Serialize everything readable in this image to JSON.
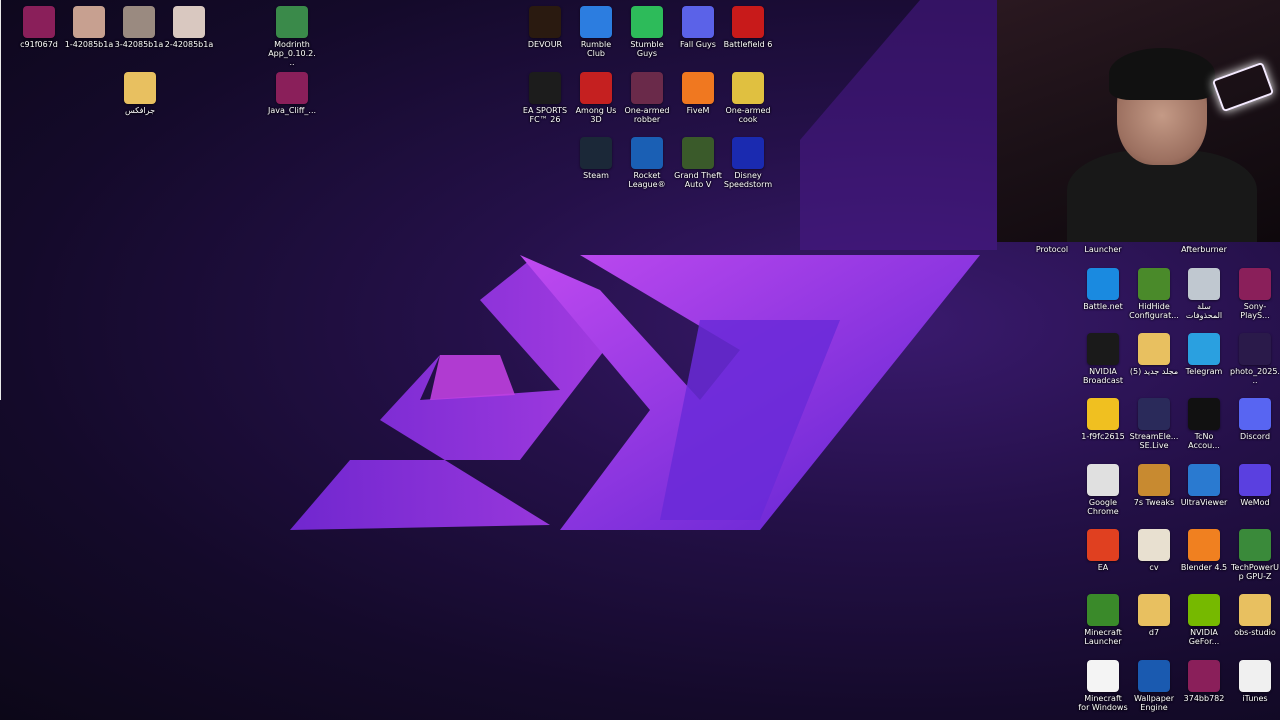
{
  "left_icons": [
    {
      "label": "c91f067d",
      "icon": "winrar-icon",
      "color": "#8a1f5a"
    },
    {
      "label": "1-42085b1a",
      "icon": "image-icon",
      "color": "#c7a090"
    },
    {
      "label": "3-42085b1a",
      "icon": "image-icon",
      "color": "#9a8a80"
    },
    {
      "label": "2-42085b1a",
      "icon": "image-icon",
      "color": "#d9c8c0"
    },
    {
      "label": "Modrinth App_0.10.2...",
      "icon": "modrinth-icon",
      "color": "#3a8a4a"
    },
    {
      "label": "جرافكس",
      "icon": "folder-icon",
      "color": "#e8c060"
    },
    {
      "label": "Java_Cliff_...",
      "icon": "winrar-icon",
      "color": "#8a1f5a"
    }
  ],
  "top_icons": [
    {
      "label": "DEVOUR",
      "icon": "devour-icon",
      "color": "#2a1a10"
    },
    {
      "label": "Rumble Club",
      "icon": "rumble-club-icon",
      "color": "#2c7de0"
    },
    {
      "label": "Stumble Guys",
      "icon": "stumble-guys-icon",
      "color": "#2dbb5a"
    },
    {
      "label": "Fall Guys",
      "icon": "fall-guys-icon",
      "color": "#5b62e8"
    },
    {
      "label": "Battlefield 6",
      "icon": "battlefield-icon",
      "color": "#c81a1a"
    },
    {
      "label": "EA SPORTS FC™ 26",
      "icon": "fc26-icon",
      "color": "#1c1c1c"
    },
    {
      "label": "Among Us 3D",
      "icon": "among-us-icon",
      "color": "#c52020"
    },
    {
      "label": "One-armed robber",
      "icon": "robber-icon",
      "color": "#6a2a4a"
    },
    {
      "label": "FiveM",
      "icon": "fivem-icon",
      "color": "#f07820"
    },
    {
      "label": "One-armed cook",
      "icon": "cook-icon",
      "color": "#e0c040"
    },
    {
      "label": "Steam",
      "icon": "steam-icon",
      "color": "#1b2838"
    },
    {
      "label": "Rocket League®",
      "icon": "rocket-league-icon",
      "color": "#1a5fb4"
    },
    {
      "label": "Grand Theft Auto V",
      "icon": "gta-icon",
      "color": "#3a5a2a"
    },
    {
      "label": "Disney Speedstorm",
      "icon": "speedstorm-icon",
      "color": "#1a2ab0"
    }
  ],
  "right_partial_labels": [
    {
      "label": "Protocol"
    },
    {
      "label": "Launcher"
    },
    {
      "label": "Afterburner"
    }
  ],
  "right_icons": [
    {
      "label": "Battle.net",
      "icon": "battlenet-icon",
      "color": "#1a8ae0"
    },
    {
      "label": "HidHide Configurat...",
      "icon": "hidhide-icon",
      "color": "#4a8a2a"
    },
    {
      "label": "سلة المحذوفات",
      "icon": "recycle-bin-icon",
      "color": "#c0c8d0"
    },
    {
      "label": "Sony-PlayS...",
      "icon": "winrar-icon",
      "color": "#8a1f5a"
    },
    {
      "label": "NVIDIA Broadcast",
      "icon": "nvidia-icon",
      "color": "#1a1a1a"
    },
    {
      "label": "مجلد جديد (5)",
      "icon": "folder-icon",
      "color": "#e8c060"
    },
    {
      "label": "Telegram",
      "icon": "telegram-icon",
      "color": "#2aa0e0"
    },
    {
      "label": "photo_2025...",
      "icon": "image-icon",
      "color": "#2a1a4a"
    },
    {
      "label": "1-f9fc2615",
      "icon": "emoji-icon",
      "color": "#f0c020"
    },
    {
      "label": "StreamEle... SE.Live",
      "icon": "streamelements-icon",
      "color": "#2a2a5a"
    },
    {
      "label": "TcNo Accou...",
      "icon": "tcno-icon",
      "color": "#111111"
    },
    {
      "label": "Discord",
      "icon": "discord-icon",
      "color": "#5865f2"
    },
    {
      "label": "Google Chrome",
      "icon": "chrome-icon",
      "color": "#e0e0e0"
    },
    {
      "label": "7s Tweaks",
      "icon": "tweaks-icon",
      "color": "#c88a30"
    },
    {
      "label": "UltraViewer",
      "icon": "ultraviewer-icon",
      "color": "#2a7ad0"
    },
    {
      "label": "WeMod",
      "icon": "wemod-icon",
      "color": "#5a40e0"
    },
    {
      "label": "EA",
      "icon": "ea-icon",
      "color": "#e04020"
    },
    {
      "label": "cv",
      "icon": "document-icon",
      "color": "#e8e0d0"
    },
    {
      "label": "Blender 4.5",
      "icon": "blender-icon",
      "color": "#f08020"
    },
    {
      "label": "TechPowerUp GPU-Z",
      "icon": "gpuz-icon",
      "color": "#3a8a3a"
    },
    {
      "label": "Minecraft Launcher",
      "icon": "minecraft-icon",
      "color": "#3a8a2a"
    },
    {
      "label": "d7",
      "icon": "document-icon",
      "color": "#e8c060"
    },
    {
      "label": "NVIDIA GeFor...",
      "icon": "geforce-icon",
      "color": "#76b900"
    },
    {
      "label": "obs-studio",
      "icon": "folder-icon",
      "color": "#e8c060"
    },
    {
      "label": "Minecraft for Windows",
      "icon": "document-icon",
      "color": "#f4f4f4"
    },
    {
      "label": "Wallpaper Engine",
      "icon": "wallpaper-engine-icon",
      "color": "#1a5ab0"
    },
    {
      "label": "374bb782",
      "icon": "winrar-icon",
      "color": "#8a1f5a"
    },
    {
      "label": "iTunes",
      "icon": "itunes-icon",
      "color": "#f0f0f0"
    }
  ]
}
